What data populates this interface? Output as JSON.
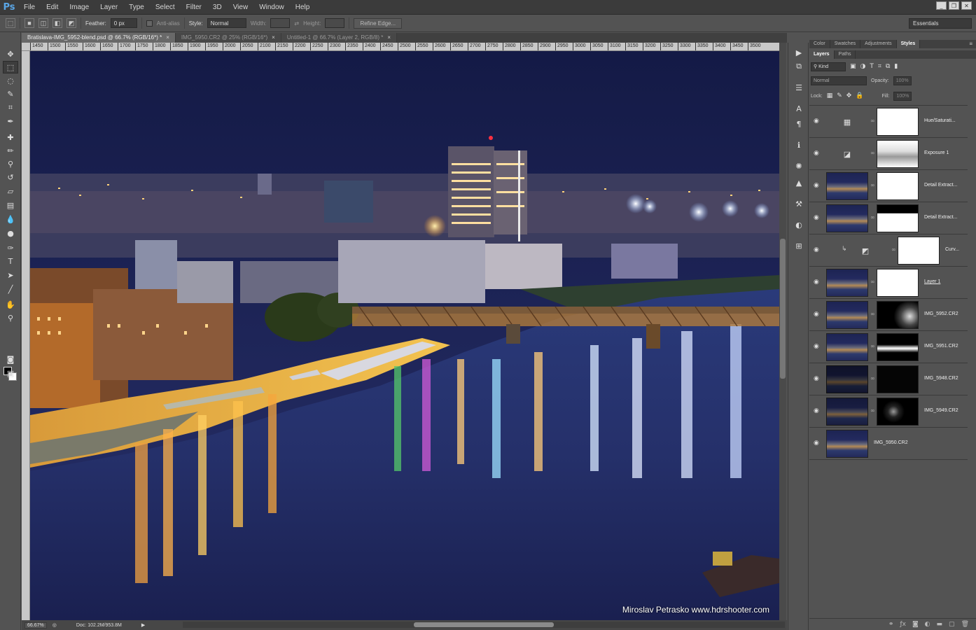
{
  "app": {
    "logo": "Ps"
  },
  "menu": [
    "File",
    "Edit",
    "Image",
    "Layer",
    "Type",
    "Select",
    "Filter",
    "3D",
    "View",
    "Window",
    "Help"
  ],
  "window_controls": [
    "_",
    "❐",
    "✕"
  ],
  "options_bar": {
    "feather_label": "Feather:",
    "feather_value": "0 px",
    "antialias_label": "Anti-alias",
    "style_label": "Style:",
    "style_value": "Normal",
    "width_label": "Width:",
    "height_label": "Height:",
    "refine_edge": "Refine Edge...",
    "workspace": "Essentials"
  },
  "doc_tabs": [
    {
      "label": "Bratislava-IMG_5952-blend.psd @ 66.7% (RGB/16*) *",
      "active": true
    },
    {
      "label": "IMG_5950.CR2 @ 25% (RGB/16*)",
      "active": false
    },
    {
      "label": "Untitled-1 @ 66.7% (Layer 2, RGB/8) *",
      "active": false
    }
  ],
  "ruler_ticks": [
    "1450",
    "1500",
    "1550",
    "1600",
    "1650",
    "1700",
    "1750",
    "1800",
    "1850",
    "1900",
    "1950",
    "2000",
    "2050",
    "2100",
    "2150",
    "2200",
    "2250",
    "2300",
    "2350",
    "2400",
    "2450",
    "2500",
    "2550",
    "2600",
    "2650",
    "2700",
    "2750",
    "2800",
    "2850",
    "2900",
    "2950",
    "3000",
    "3050",
    "3100",
    "3150",
    "3200",
    "3250",
    "3300",
    "3350",
    "3400",
    "3450",
    "3500"
  ],
  "canvas": {
    "watermark": "Miroslav Petrasko www.hdrshooter.com"
  },
  "status": {
    "zoom": "66.67%",
    "doc": "Doc: 102.2M/953.8M"
  },
  "panels": {
    "top_tabs": [
      "Color",
      "Swatches",
      "Adjustments",
      "Styles"
    ],
    "top_active": "Styles",
    "layer_tabs": [
      "Layers",
      "Paths"
    ],
    "layer_active": "Layers",
    "filter_kind": "Kind",
    "blend_mode": "Normal",
    "opacity_label": "Opacity:",
    "opacity_value": "100%",
    "lock_label": "Lock:",
    "fill_label": "Fill:",
    "fill_value": "100%"
  },
  "layers": [
    {
      "name": "Hue/Saturati...",
      "type": "adjustment",
      "icon": "hue-saturation-icon",
      "mask": "white"
    },
    {
      "name": "Exposure 1",
      "type": "adjustment",
      "icon": "exposure-icon",
      "mask": "texture"
    },
    {
      "name": "Detail Extract...",
      "type": "image",
      "mask": "white"
    },
    {
      "name": "Detail Extract...",
      "type": "image",
      "mask": "white-bottom-black"
    },
    {
      "name": "Curv...",
      "type": "adjustment",
      "icon": "curves-icon",
      "mask": "white",
      "clipped": true
    },
    {
      "name": "Layer 1",
      "type": "image",
      "mask": "white"
    },
    {
      "name": "IMG_5952.CR2",
      "type": "image",
      "mask": "dark-with-white"
    },
    {
      "name": "IMG_5951.CR2",
      "type": "image",
      "mask": "dark-with-white"
    },
    {
      "name": "IMG_5948.CR2",
      "type": "image",
      "mask": "black"
    },
    {
      "name": "IMG_5949.CR2",
      "type": "image",
      "mask": "dark-with-white"
    },
    {
      "name": "IMG_5950.CR2",
      "type": "image",
      "mask": "none"
    }
  ]
}
